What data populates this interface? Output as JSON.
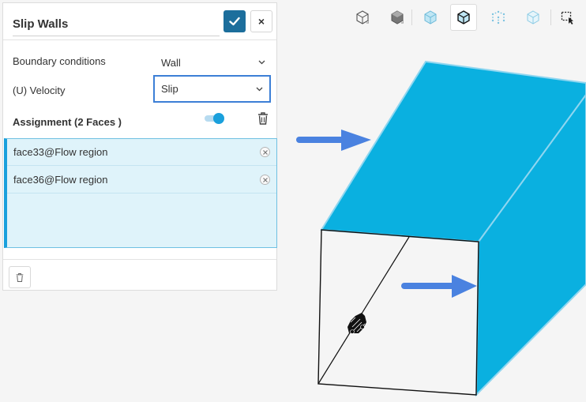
{
  "panel": {
    "title": "Slip Walls",
    "confirm_icon": "check-icon",
    "close_label": "×",
    "boundary_conditions_label": "Boundary conditions",
    "boundary_conditions_value": "Wall",
    "velocity_label": "(U) Velocity",
    "velocity_value": "Slip",
    "assignment_label": "Assignment (2 Faces )",
    "assignment_toggle_on": true,
    "faces": [
      {
        "name": "face33@Flow region"
      },
      {
        "name": "face36@Flow region"
      }
    ]
  },
  "toolbar": {
    "buttons": [
      {
        "icon": "view-back-icon"
      },
      {
        "icon": "view-solid-icon"
      },
      {
        "icon": "view-transparent-icon"
      },
      {
        "icon": "view-wireframe-icon"
      },
      {
        "icon": "view-points-icon"
      },
      {
        "icon": "view-outline-icon"
      },
      {
        "icon": "box-select-icon"
      }
    ]
  },
  "colors": {
    "accent": "#1c6e9c",
    "selected_face": "#0ab0e0",
    "selection_bg": "#dff3fa",
    "arrow": "#4a82e0",
    "focus_border": "#3c7fd6"
  }
}
